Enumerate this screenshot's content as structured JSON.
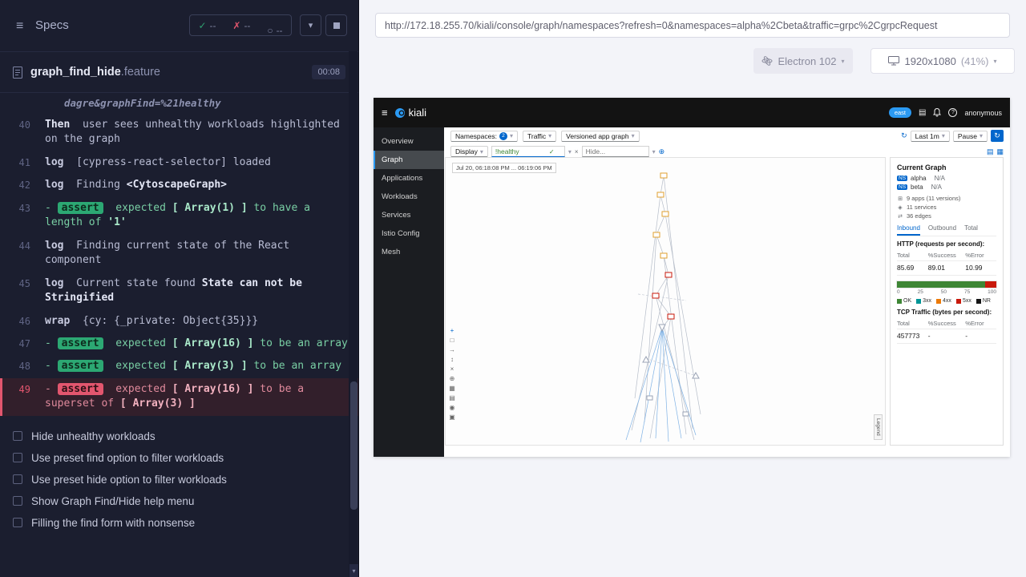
{
  "cypress": {
    "header": {
      "title": "Specs",
      "stats": {
        "passed": "--",
        "failed": "--",
        "pending": "--"
      }
    },
    "spec": {
      "name": "graph_find_hide",
      "ext": ".feature",
      "duration": "00:08"
    },
    "log": {
      "overflow_text": "dagre&graphFind=%21healthy",
      "lines": [
        {
          "num": "40",
          "kind": "step",
          "method": "Then",
          "segments": [
            {
              "text": "user sees unhealthy workloads highlighted on the graph",
              "bold": false
            }
          ]
        },
        {
          "num": "41",
          "kind": "log",
          "method": "log",
          "segments": [
            {
              "text": "[cypress-react-selector] loaded",
              "bold": false
            }
          ]
        },
        {
          "num": "42",
          "kind": "log",
          "method": "log",
          "segments": [
            {
              "text": "Finding ",
              "bold": false
            },
            {
              "text": "<CytoscapeGraph>",
              "bold": true
            }
          ]
        },
        {
          "num": "43",
          "kind": "assert-pass",
          "method": "assert",
          "segments": [
            {
              "text": "expected ",
              "bold": false
            },
            {
              "text": "[ Array(1) ]",
              "bold": true
            },
            {
              "text": " to have a length of ",
              "bold": false
            },
            {
              "text": "'1'",
              "bold": true
            }
          ]
        },
        {
          "num": "44",
          "kind": "log",
          "method": "log",
          "segments": [
            {
              "text": "Finding current state of the React component",
              "bold": false
            }
          ]
        },
        {
          "num": "45",
          "kind": "log",
          "method": "log",
          "segments": [
            {
              "text": "Current state found ",
              "bold": false
            },
            {
              "text": "State can not be Stringified",
              "bold": true
            }
          ]
        },
        {
          "num": "46",
          "kind": "log",
          "method": "wrap",
          "segments": [
            {
              "text": "{cy: {_private: Object{35}}}",
              "bold": false
            }
          ]
        },
        {
          "num": "47",
          "kind": "assert-pass",
          "method": "assert",
          "segments": [
            {
              "text": "expected ",
              "bold": false
            },
            {
              "text": "[ Array(16) ]",
              "bold": true
            },
            {
              "text": " to be an array",
              "bold": false
            }
          ]
        },
        {
          "num": "48",
          "kind": "assert-pass",
          "method": "assert",
          "segments": [
            {
              "text": "expected ",
              "bold": false
            },
            {
              "text": "[ Array(3) ]",
              "bold": true
            },
            {
              "text": " to be an array",
              "bold": false
            }
          ]
        },
        {
          "num": "49",
          "kind": "assert-fail",
          "method": "assert",
          "segments": [
            {
              "text": "expected ",
              "bold": false
            },
            {
              "text": "[ Array(16) ]",
              "bold": true
            },
            {
              "text": " to be a superset of ",
              "bold": false
            },
            {
              "text": "[ Array(3) ]",
              "bold": true
            }
          ]
        }
      ]
    },
    "pending_tests": [
      "Hide unhealthy workloads",
      "Use preset find option to filter workloads",
      "Use preset hide option to filter workloads",
      "Show Graph Find/Hide help menu",
      "Filling the find form with nonsense"
    ]
  },
  "browser_bar": {
    "url": "http://172.18.255.70/kiali/console/graph/namespaces?refresh=0&namespaces=alpha%2Cbeta&traffic=grpc%2CgrpcRequest",
    "browser_name": "Electron 102",
    "viewport_size": "1920x1080",
    "viewport_scale": "(41%)"
  },
  "kiali": {
    "masthead": {
      "brand": "kiali",
      "cluster_badge": "east",
      "user": "anonymous"
    },
    "nav": [
      {
        "label": "Overview",
        "active": false
      },
      {
        "label": "Graph",
        "active": true
      },
      {
        "label": "Applications",
        "active": false
      },
      {
        "label": "Workloads",
        "active": false
      },
      {
        "label": "Services",
        "active": false
      },
      {
        "label": "Istio Config",
        "active": false
      },
      {
        "label": "Mesh",
        "active": false
      }
    ],
    "toolbar": {
      "namespaces_label": "Namespaces:",
      "namespaces_count": "2",
      "traffic_label": "Traffic",
      "graph_type_label": "Versioned app graph",
      "display_label": "Display",
      "find_value": "!healthy",
      "hide_placeholder": "Hide...",
      "interval_label": "Last 1m",
      "refresh_label": "Pause"
    },
    "time_range": "Jul 20, 06:18:08 PM ... 06:19:06 PM",
    "legend_label": "Legend",
    "graph_toolbar_icons": [
      {
        "name": "center-graph-icon",
        "glyph": "+"
      },
      {
        "name": "fit-to-screen-icon",
        "glyph": "□"
      },
      {
        "name": "forward-icon",
        "glyph": "→"
      },
      {
        "name": "expand-icon",
        "glyph": "↕"
      },
      {
        "name": "clear-icon",
        "glyph": "×"
      },
      {
        "name": "zoom-in-icon",
        "glyph": "⊕"
      },
      {
        "name": "grid-icon",
        "glyph": "▦"
      },
      {
        "name": "layers-icon",
        "glyph": "▤"
      },
      {
        "name": "target-icon",
        "glyph": "◉"
      },
      {
        "name": "layout-icon",
        "glyph": "▣"
      }
    ],
    "side_panel": {
      "title": "Current Graph",
      "namespaces": [
        {
          "badge": "NS",
          "name": "alpha",
          "value": "N/A"
        },
        {
          "badge": "NS",
          "name": "beta",
          "value": "N/A"
        }
      ],
      "summary": [
        {
          "icon": "apps-icon",
          "text": "9 apps (11 versions)"
        },
        {
          "icon": "services-icon",
          "text": "11 services"
        },
        {
          "icon": "edges-icon",
          "text": "36 edges"
        }
      ],
      "tabs": [
        {
          "label": "Inbound",
          "active": true
        },
        {
          "label": "Outbound",
          "active": false
        },
        {
          "label": "Total",
          "active": false
        }
      ],
      "http_title": "HTTP (requests per second):",
      "http_table": {
        "headers": [
          "Total",
          "%Success",
          "%Error"
        ],
        "values": [
          "85.69",
          "89.01",
          "10.99"
        ]
      },
      "rate_chart": {
        "type": "bar",
        "segments": [
          {
            "label": "OK",
            "value": 89.01,
            "color": "#3e8635"
          },
          {
            "label": "Error",
            "value": 10.99,
            "color": "#c9190b"
          }
        ],
        "axis": [
          "0",
          "25",
          "50",
          "75",
          "100"
        ]
      },
      "legend": [
        {
          "label": "OK",
          "color": "#3e8635"
        },
        {
          "label": "3xx",
          "color": "#009596"
        },
        {
          "label": "4xx",
          "color": "#ec7a08"
        },
        {
          "label": "5xx",
          "color": "#c9190b"
        },
        {
          "label": "NR",
          "color": "#151515"
        }
      ],
      "tcp_title": "TCP Traffic (bytes per second):",
      "tcp_table": {
        "headers": [
          "Total",
          "%Success",
          "%Error"
        ],
        "values": [
          "457773",
          "-",
          "-"
        ]
      }
    }
  }
}
